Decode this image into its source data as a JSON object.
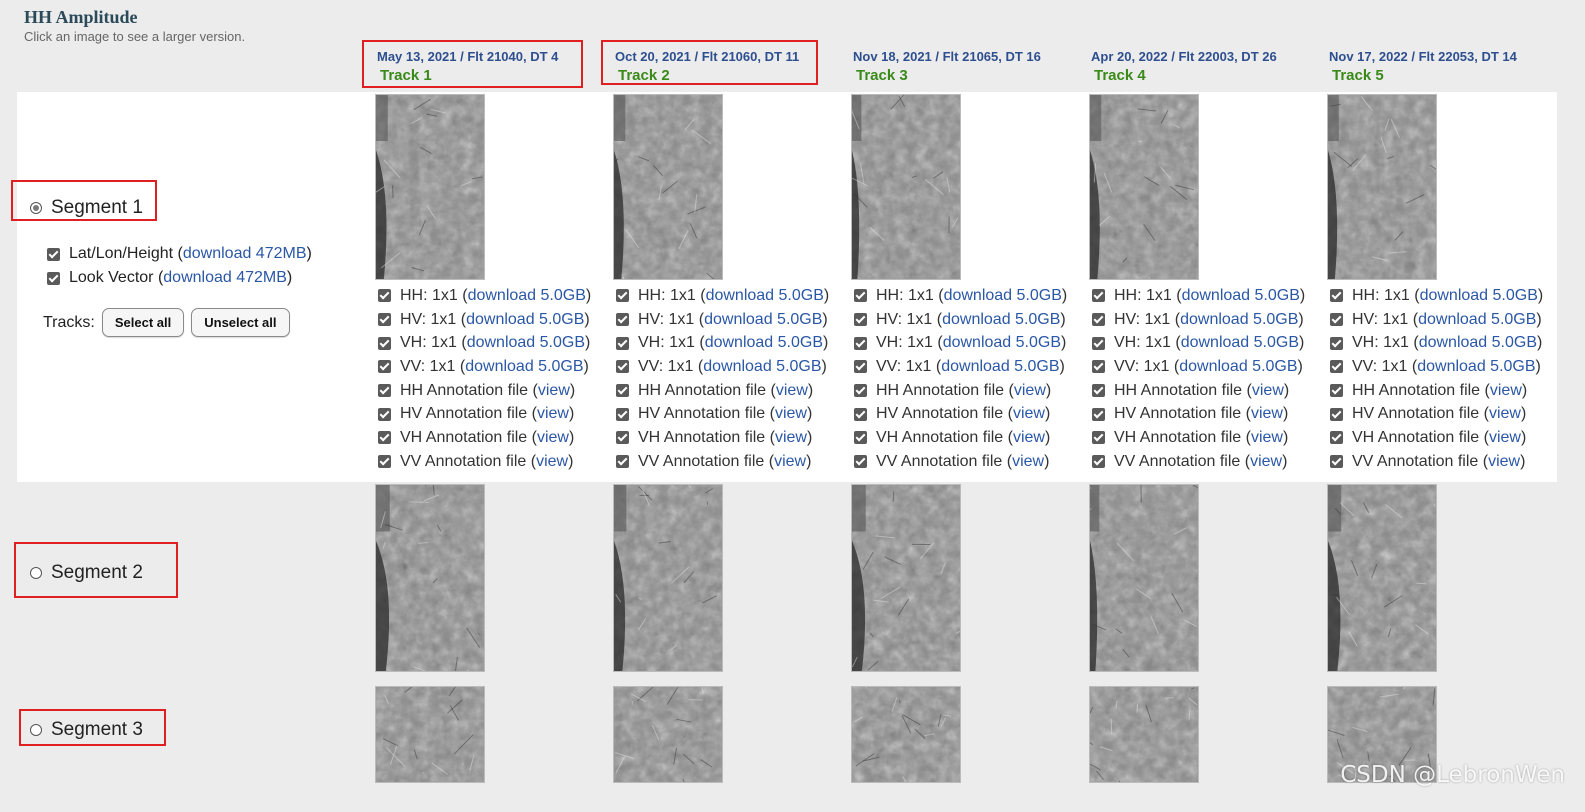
{
  "header": {
    "title": "HH Amplitude",
    "subtitle": "Click an image to see a larger version."
  },
  "tracks": [
    {
      "date": "May 13, 2021 / Flt 21040, DT 4",
      "name": "Track 1"
    },
    {
      "date": "Oct 20, 2021 / Flt 21060, DT 11",
      "name": "Track 2"
    },
    {
      "date": "Nov 18, 2021 / Flt 21065, DT 16",
      "name": "Track 3"
    },
    {
      "date": "Apr 20, 2022 / Flt 22003, DT 26",
      "name": "Track 4"
    },
    {
      "date": "Nov 17, 2022 / Flt 22053, DT 14",
      "name": "Track 5"
    }
  ],
  "segments": [
    {
      "label": "Segment 1",
      "selected": true
    },
    {
      "label": "Segment 2",
      "selected": false
    },
    {
      "label": "Segment 3",
      "selected": false
    }
  ],
  "segment1": {
    "latlon": {
      "label": "Lat/Lon/Height (",
      "link": "download 472MB",
      "close": ")"
    },
    "lookvec": {
      "label": "Look Vector (",
      "link": "download 472MB",
      "close": ")"
    },
    "tracks_label": "Tracks:",
    "select_all": "Select all",
    "unselect_all": "Unselect all",
    "files": [
      {
        "label": "HH: 1x1 (",
        "link": "download 5.0GB",
        "close": ")"
      },
      {
        "label": "HV: 1x1 (",
        "link": "download 5.0GB",
        "close": ")"
      },
      {
        "label": "VH: 1x1 (",
        "link": "download 5.0GB",
        "close": ")"
      },
      {
        "label": "VV: 1x1 (",
        "link": "download 5.0GB",
        "close": ")"
      },
      {
        "label": "HH Annotation file (",
        "link": "view",
        "close": ")"
      },
      {
        "label": "HV Annotation file (",
        "link": "view",
        "close": ")"
      },
      {
        "label": "VH Annotation file (",
        "link": "view",
        "close": ")"
      },
      {
        "label": "VV Annotation file (",
        "link": "view",
        "close": ")"
      }
    ]
  },
  "watermark": "CSDN @LebronWen",
  "colors": {
    "highlight_box": "#e02020",
    "track_name": "#3a8a1a",
    "track_date": "#2e4f8f",
    "link": "#2a57a6"
  }
}
